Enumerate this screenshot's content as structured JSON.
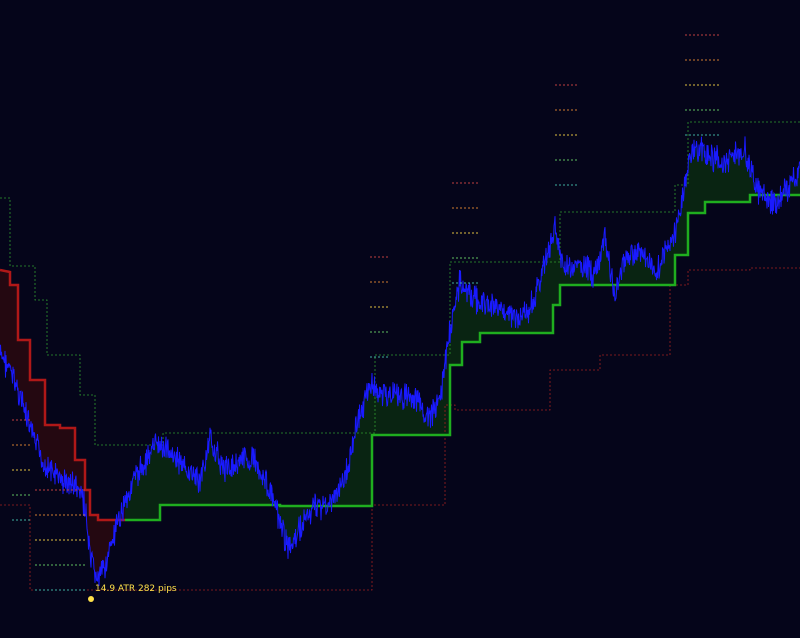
{
  "chart_data": {
    "type": "line",
    "title": "",
    "xlabel": "",
    "ylabel": "",
    "annotation": "14.9 ATR  282 pips",
    "colors": {
      "background": "#05051a",
      "price": "#1a1aff",
      "trail_up": "#1fae1f",
      "trail_down": "#b01818",
      "fill_up": "#0b2a12",
      "fill_down": "#2a0910",
      "band_upper": "#2f9a2f",
      "band_lower": "#a02020",
      "annotation": "#ffe14a"
    },
    "level_ticks": [
      "#c04040",
      "#d07a30",
      "#e0c040",
      "#60c060",
      "#40b0a0"
    ],
    "ylim": [
      0,
      100
    ]
  }
}
